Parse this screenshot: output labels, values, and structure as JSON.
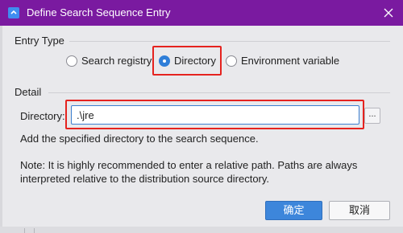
{
  "window": {
    "title": "Define Search Sequence Entry",
    "title_bar_color": "#7a1aa0",
    "app_icon": "app-dialog-icon",
    "close_icon": "close-icon"
  },
  "entry_type": {
    "label": "Entry Type",
    "options": [
      {
        "label": "Search registry",
        "checked": false
      },
      {
        "label": "Directory",
        "checked": true
      },
      {
        "label": "Environment variable",
        "checked": false
      }
    ]
  },
  "detail": {
    "label": "Detail",
    "directory_label": "Directory:",
    "directory_value": ".\\jre",
    "browse_label": "...",
    "description": "Add the specified directory to the search sequence.",
    "note_line1": "Note: It is highly recommended to enter a relative path. Paths are always",
    "note_line2": "interpreted relative to the distribution source directory."
  },
  "buttons": {
    "ok_label": "确定",
    "cancel_label": "取消"
  },
  "colors": {
    "accent": "#3d86db",
    "highlight": "#e5231f"
  }
}
